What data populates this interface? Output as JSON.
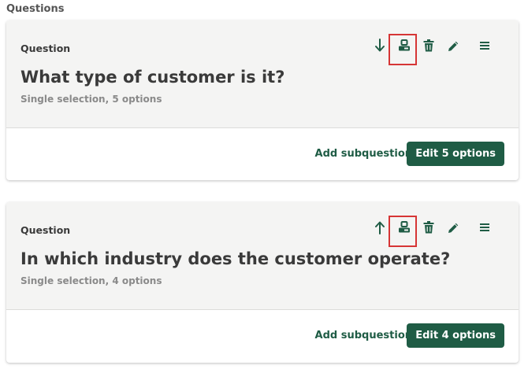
{
  "section_title": "Questions",
  "accent_color": "#1f5c45",
  "highlight_color": "#d63535",
  "questions": [
    {
      "label": "Question",
      "title": "What type of customer is it?",
      "subtitle": "Single selection, 5 options",
      "move_icon": "arrow-down-icon",
      "add_subquestion_label": "Add subquestion",
      "edit_button_label": "Edit 5 options"
    },
    {
      "label": "Question",
      "title": "In which industry does the customer operate?",
      "subtitle": "Single selection, 4 options",
      "move_icon": "arrow-up-icon",
      "add_subquestion_label": "Add subquestion",
      "edit_button_label": "Edit 4 options"
    }
  ],
  "toolbar_icons": [
    "move-icon",
    "duplicate-icon",
    "trash-icon",
    "pencil-icon",
    "menu-icon"
  ]
}
